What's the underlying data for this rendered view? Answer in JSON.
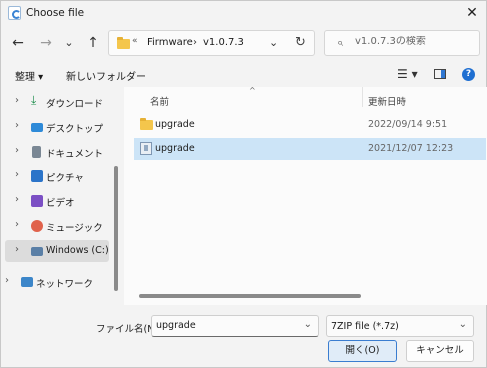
{
  "window": {
    "title": "Choose file",
    "close_glyph": "✕"
  },
  "nav": {
    "back": "←",
    "forward": "→",
    "recent": "⌄",
    "up": "↑"
  },
  "address": {
    "chevron": "«",
    "crumbs": [
      "Firmware",
      "v1.0.7.3"
    ],
    "separator": "›",
    "dropdown": "⌄",
    "refresh": "↻"
  },
  "search": {
    "placeholder": "v1.0.7.3の検索",
    "icon": "⌕"
  },
  "commands": {
    "organize": "整理 ▾",
    "new_folder": "新しいフォルダー",
    "view_icon": "☰ ▾",
    "help_icon": "?"
  },
  "sidebar": {
    "items": [
      {
        "label": "ダウンロード",
        "icon": "download-icon",
        "arrow": "›",
        "color": "#1f8f4e"
      },
      {
        "label": "デスクトップ",
        "icon": "desktop-icon",
        "arrow": "›",
        "color": "#2e8ad8"
      },
      {
        "label": "ドキュメント",
        "icon": "documents-icon",
        "arrow": "›",
        "color": "#7a8794"
      },
      {
        "label": "ピクチャ",
        "icon": "pictures-icon",
        "arrow": "›",
        "color": "#2b74c9"
      },
      {
        "label": "ビデオ",
        "icon": "videos-icon",
        "arrow": "›",
        "color": "#7b4fc4"
      },
      {
        "label": "ミュージック",
        "icon": "music-icon",
        "arrow": "›",
        "color": "#e0624b"
      },
      {
        "label": "Windows (C:)",
        "icon": "drive-icon",
        "arrow": "›",
        "color": "#5a7fa6"
      },
      {
        "label": "ネットワーク",
        "icon": "network-icon",
        "arrow": "›",
        "color": "#3c86c9"
      }
    ]
  },
  "filelist": {
    "columns": {
      "name": "名前",
      "date": "更新日時"
    },
    "sort_caret": "^",
    "rows": [
      {
        "name": "upgrade",
        "date": "2022/09/14 9:51",
        "type": "folder"
      },
      {
        "name": "upgrade",
        "date": "2021/12/07 12:23",
        "type": "7z"
      }
    ]
  },
  "footer": {
    "filename_label": "ファイル名(N):",
    "filename_value": "upgrade",
    "filetype": "7ZIP file (*.7z)",
    "open": "開く(O)",
    "cancel": "キャンセル",
    "dd": "⌄"
  }
}
